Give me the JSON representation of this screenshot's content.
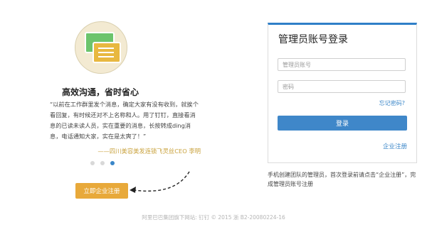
{
  "promo": {
    "headline": "高效沟通，省时省心",
    "quote": "“以前在工作群里发个消息，确定大家有没有收到，就挨个看回复，有时候还对不上名称和人。用了钉钉，直接看消息的已读未读人员，实在重要的消息，长按转成ding消息，电话通知大家，实在是太爽了！”",
    "signature": "——四川美容美发连锁飞灵丝CEO 李明",
    "carousel_dots": 3,
    "active_dot": 2,
    "register_button": "立即企业注册"
  },
  "login": {
    "title": "管理员账号登录",
    "account_placeholder": "管理员账号",
    "password_placeholder": "密码",
    "forgot_link": "忘记密码?",
    "login_button": "登录",
    "corp_register_link": "企业注册"
  },
  "tip": "手机创建团队的管理员，首次登录前请点击“企业注册”，完成管理员账号注册",
  "footer": "阿里巴巴集团旗下网站: 钉钉 © 2015 浙 B2-20080224-16",
  "colors": {
    "accent_blue": "#3f87c9",
    "accent_orange": "#e8a93a",
    "signature_gold": "#c9a23d"
  }
}
